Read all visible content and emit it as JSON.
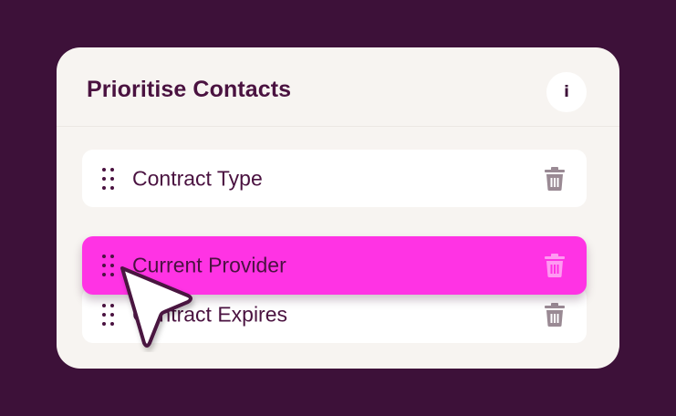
{
  "panel": {
    "title": "Prioritise Contacts",
    "info_label": "i"
  },
  "rows": [
    {
      "label": "Contract Type"
    },
    {
      "label": "Current Provider"
    },
    {
      "label": "Contract Expires"
    }
  ],
  "icons": {
    "drag": "drag-handle-icon",
    "delete": "trash-icon",
    "info": "info-icon",
    "pointer": "cursor-icon"
  },
  "colors": {
    "background": "#3d1139",
    "card": "#f7f4f1",
    "text": "#4a1240",
    "highlight": "#ff33e4",
    "trash": "#9a8a94"
  }
}
